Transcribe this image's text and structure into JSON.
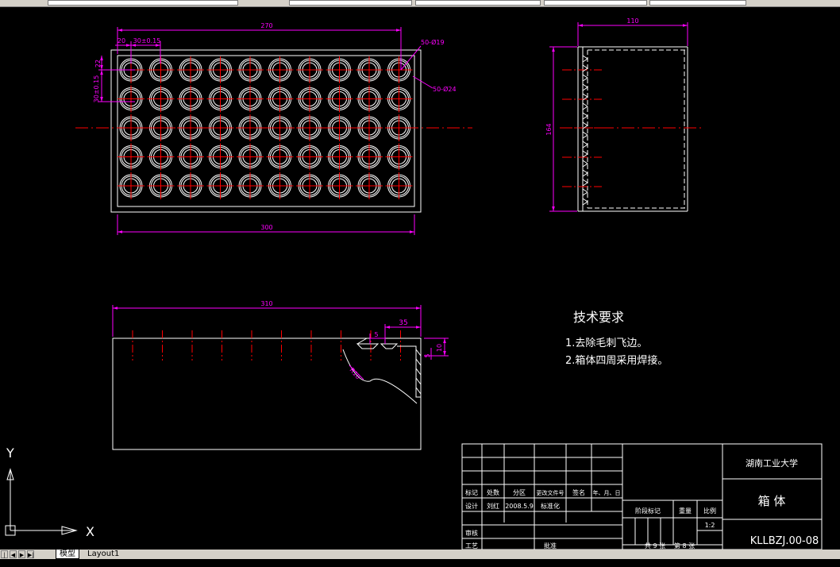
{
  "colors": {
    "background": "#000000",
    "outline": "#ffffff",
    "dimension": "#ff00ff",
    "centerline": "#ff0000",
    "hidden": "#00ffff"
  },
  "dimensions": {
    "top_270": "270",
    "top_20": "20",
    "pitch_x": "30±0.15",
    "hole_19": "50-Ø19",
    "hole_24": "50-Ø24",
    "left_22": "22",
    "pitch_y": "30±0.15",
    "bottom_300": "300",
    "side_110": "110",
    "side_164": "164",
    "front_310": "310",
    "front_35": "35",
    "front_5a": "5",
    "front_10": "10",
    "front_5b": "5",
    "front_r": "R10"
  },
  "notes": {
    "title": "技术要求",
    "item1": "1.去除毛刺飞边。",
    "item2": "2.箱体四周采用焊接。"
  },
  "title_block": {
    "university": "湖南工业大学",
    "part_name": "箱 体",
    "drawing_number": "KLLBZJ.00-08",
    "mark": "标记",
    "count": "处数",
    "zone": "分区",
    "change_doc": "更改文件号",
    "sign": "签名",
    "date_label": "年、月、日",
    "design": "设计",
    "designer": "刘红",
    "date": "2008.5.9",
    "standardize": "标准化",
    "stage_mark": "阶段标记",
    "weight": "重量",
    "scale_label": "比例",
    "scale": "1:2",
    "review": "审核",
    "process": "工艺",
    "approve": "批准",
    "sheets": "共 9 张",
    "sheet_no": "第 8 张"
  },
  "ucs": {
    "x_label": "X",
    "y_label": "Y"
  },
  "status_bar": {
    "nav_first": "|◀",
    "nav_prev": "◀",
    "nav_next": "▶",
    "nav_last": "▶|",
    "tab_model": "模型",
    "tab_layout1": "Layout1"
  }
}
